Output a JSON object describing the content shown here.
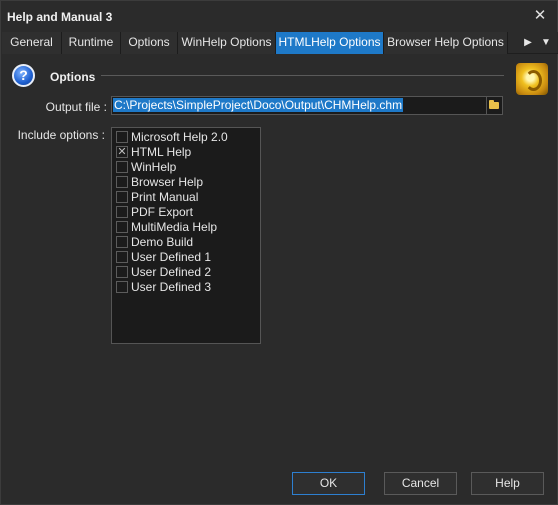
{
  "window": {
    "title": "Help and Manual 3"
  },
  "icons": {
    "close": "close-icon",
    "help": "question-circle-icon",
    "logo": "help-and-manual-logo-icon",
    "browse": "folder-icon",
    "tab_next": "arrow-right-icon",
    "tab_menu": "menu-down-icon"
  },
  "colors": {
    "accent": "#1e79c8",
    "background": "#2b2b2b",
    "field": "#1b1b1b"
  },
  "tabs": [
    {
      "label": "General",
      "active": false
    },
    {
      "label": "Runtime",
      "active": false
    },
    {
      "label": "Options",
      "active": false
    },
    {
      "label": "WinHelp Options",
      "active": false
    },
    {
      "label": "HTMLHelp Options",
      "active": true
    },
    {
      "label": "Browser Help Options",
      "active": false
    }
  ],
  "section": {
    "title": "Options"
  },
  "output": {
    "label": "Output file :",
    "value": "C:\\Projects\\SimpleProject\\Doco\\Output\\CHMHelp.chm"
  },
  "include": {
    "label": "Include options :",
    "items": [
      {
        "label": "Microsoft Help 2.0",
        "checked": false
      },
      {
        "label": "HTML Help",
        "checked": true
      },
      {
        "label": "WinHelp",
        "checked": false
      },
      {
        "label": "Browser Help",
        "checked": false
      },
      {
        "label": "Print Manual",
        "checked": false
      },
      {
        "label": "PDF Export",
        "checked": false
      },
      {
        "label": "MultiMedia Help",
        "checked": false
      },
      {
        "label": "Demo Build",
        "checked": false
      },
      {
        "label": "User Defined 1",
        "checked": false
      },
      {
        "label": "User Defined 2",
        "checked": false
      },
      {
        "label": "User Defined 3",
        "checked": false
      }
    ]
  },
  "buttons": {
    "ok": "OK",
    "cancel": "Cancel",
    "help": "Help"
  }
}
